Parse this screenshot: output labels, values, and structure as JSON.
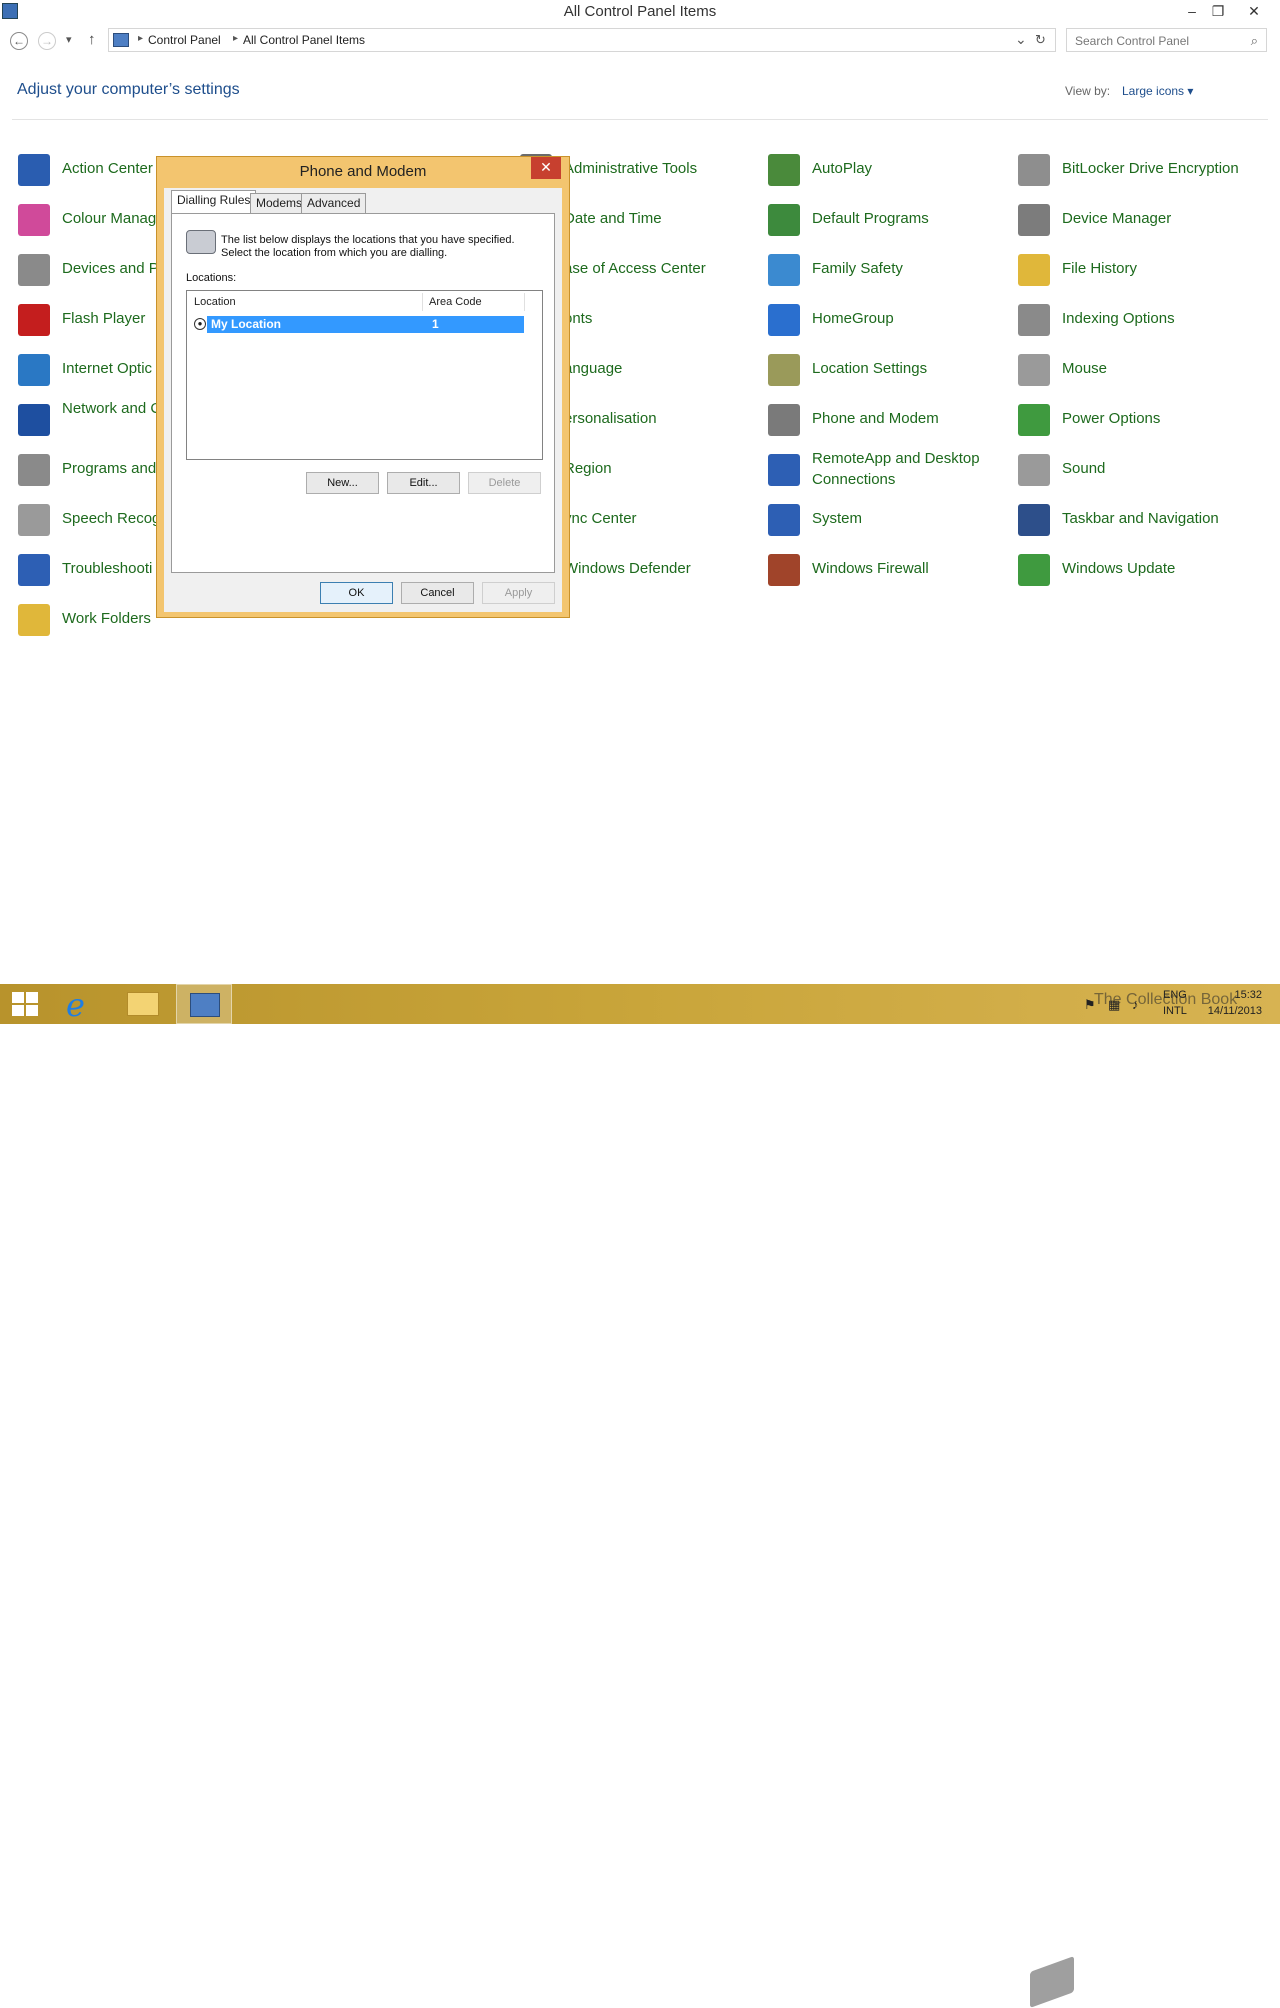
{
  "window": {
    "title": "All Control Panel Items",
    "minimize": "–",
    "restore": "❐",
    "close": "✕"
  },
  "nav": {
    "back": "←",
    "forward": "→",
    "history": "▾",
    "up": "↑",
    "breadcrumbs": [
      "Control Panel",
      "All Control Panel Items"
    ],
    "addr_dropdown": "⌄",
    "refresh": "↻",
    "search_placeholder": "Search Control Panel",
    "search_icon": "⌕"
  },
  "header": {
    "title": "Adjust your computer’s settings",
    "view_by_label": "View by:",
    "view_by_value": "Large icons ▾"
  },
  "items": [
    {
      "label": "Action Center",
      "color": "#2a5db0"
    },
    {
      "label": "Administrative Tools",
      "color": "#6b6b6b"
    },
    {
      "label": "AutoPlay",
      "color": "#4a8a3b"
    },
    {
      "label": "BitLocker Drive Encryption",
      "color": "#8e8e8e"
    },
    {
      "label": "Colour Manag",
      "color": "#d04a9a"
    },
    {
      "label": "Date and Time",
      "color": "#5a7cc0"
    },
    {
      "label": "Default Programs",
      "color": "#3d8a3d"
    },
    {
      "label": "Device Manager",
      "color": "#7c7c7c"
    },
    {
      "label": "Devices and P",
      "color": "#8a8a8a"
    },
    {
      "label": "ase of Access Center",
      "color": "#2e6dc1"
    },
    {
      "label": "Family Safety",
      "color": "#3b8ad0"
    },
    {
      "label": "File History",
      "color": "#e0b73a"
    },
    {
      "label": "Flash Player",
      "color": "#c41e1e"
    },
    {
      "label": "onts",
      "color": "#d0a642"
    },
    {
      "label": "HomeGroup",
      "color": "#2a6fcf"
    },
    {
      "label": "Indexing Options",
      "color": "#8a8a8a"
    },
    {
      "label": "Internet Optic",
      "color": "#2a78c4"
    },
    {
      "label": "anguage",
      "color": "#3a6cc4"
    },
    {
      "label": "Location Settings",
      "color": "#9a9a5a"
    },
    {
      "label": "Mouse",
      "color": "#9a9a9a"
    },
    {
      "label": "Network and Center",
      "color": "#1e4fa0"
    },
    {
      "label": "ersonalisation",
      "color": "#5a7fc0"
    },
    {
      "label": "Phone and Modem",
      "color": "#7a7a7a"
    },
    {
      "label": "Power Options",
      "color": "#3f9a3f"
    },
    {
      "label": "Programs and",
      "color": "#8a8a8a"
    },
    {
      "label": "Region",
      "color": "#3c7cc4"
    },
    {
      "label": "RemoteApp and Desktop Connections",
      "color": "#2d5fb4"
    },
    {
      "label": "Sound",
      "color": "#9a9a9a"
    },
    {
      "label": "Speech Recog",
      "color": "#9a9a9a"
    },
    {
      "label": "ync Center",
      "color": "#3aa03a"
    },
    {
      "label": "System",
      "color": "#2d5fb4"
    },
    {
      "label": "Taskbar and Navigation",
      "color": "#2d4f8a"
    },
    {
      "label": "Troubleshooti",
      "color": "#2d5fb4"
    },
    {
      "label": "Windows Defender",
      "color": "#6a6a6a"
    },
    {
      "label": "Windows Firewall",
      "color": "#a0442a"
    },
    {
      "label": "Windows Update",
      "color": "#3f9a3f"
    },
    {
      "label": "Work Folders",
      "color": "#e0b73a"
    }
  ],
  "dialog": {
    "title": "Phone and Modem",
    "close": "✕",
    "tabs": [
      "Dialling Rules",
      "Modems",
      "Advanced"
    ],
    "info_line1": "The list below displays the locations that you have specified.",
    "info_line2": "Select the location from which you are dialling.",
    "locations_label": "Locations:",
    "columns": [
      "Location",
      "Area Code"
    ],
    "rows": [
      {
        "location": "My Location",
        "area_code": "1"
      }
    ],
    "buttons": {
      "new": "New...",
      "edit": "Edit...",
      "delete": "Delete",
      "ok": "OK",
      "cancel": "Cancel",
      "apply": "Apply"
    }
  },
  "taskbar": {
    "tray_lang1": "ENG",
    "tray_lang2": "INTL",
    "time": "15:32",
    "date": "14/11/2013",
    "watermark": "The Collection Book"
  }
}
